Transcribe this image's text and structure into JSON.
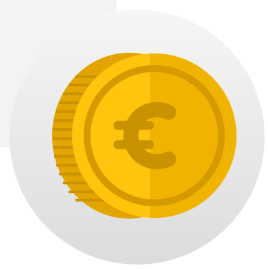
{
  "icon": {
    "name": "euro-coin",
    "symbol": "€",
    "colors": {
      "background_circle_top": "#f6f6f6",
      "background_circle_bottom": "#dcdcdc",
      "backdrop_rect": "#f3f3f3",
      "coin_face_light": "#ffc40c",
      "coin_face_shade": "#f0b400",
      "coin_edge": "#e1a400",
      "coin_edge_ridge": "#c99200",
      "coin_inner_ring": "#d49a00",
      "coin_symbol": "#c99200"
    }
  }
}
